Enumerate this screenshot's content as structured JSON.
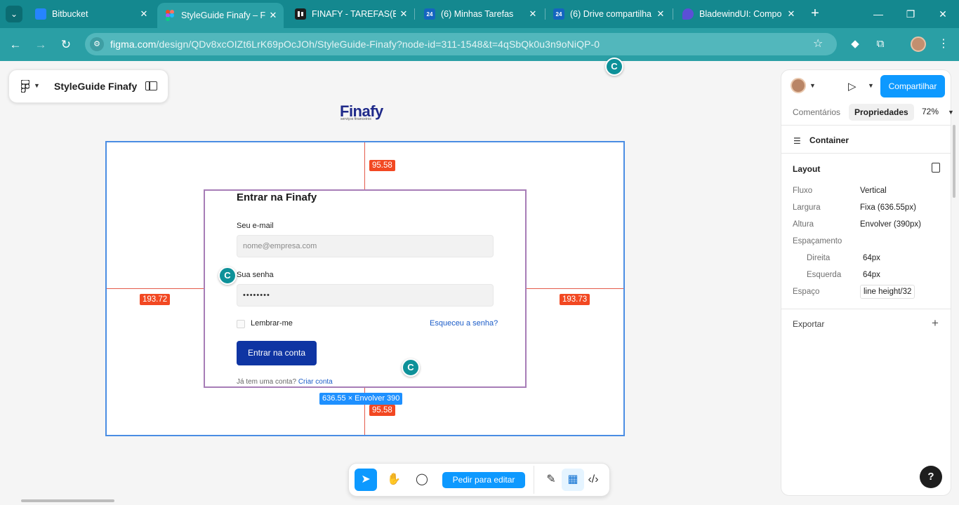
{
  "browser": {
    "tab_menu_icon": "chevron-down-icon",
    "tabs": [
      {
        "title": "Bitbucket",
        "favicon_color": "#2684ff",
        "favicon_text": ""
      },
      {
        "title": "StyleGuide Finafy – Fi",
        "favicon_color": "#a259ff",
        "favicon_text": ""
      },
      {
        "title": "FINAFY - TAREFAS(BIT",
        "favicon_color": "#1d1d1d",
        "favicon_text": ""
      },
      {
        "title": "(6) Minhas Tarefas",
        "favicon_color": "#1565c0",
        "favicon_text": "24"
      },
      {
        "title": "(6) Drive compartilha",
        "favicon_color": "#1565c0",
        "favicon_text": "24"
      },
      {
        "title": "BladewindUI: Compo",
        "favicon_color": "#5b4fd6",
        "favicon_text": ""
      }
    ],
    "close_glyph": "✕",
    "url_domain": "figma.com",
    "url_path": "/design/QDv8xcOIZt6LrK69pOcJOh/StyleGuide-Finafy?node-id=311-1548&t=4qSbQk0u3n9oNiQP-0"
  },
  "figma": {
    "file_name": "StyleGuide Finafy",
    "collaborator_initial": "C",
    "edit_button": "Pedir para editar",
    "share_button": "Compartilhar",
    "panel_tabs": [
      "Comentários",
      "Propriedades"
    ],
    "zoom": "72%",
    "selected_component": "Container",
    "layout_title": "Layout",
    "export_title": "Exportar",
    "properties": [
      {
        "label": "Fluxo",
        "value": "Vertical"
      },
      {
        "label": "Largura",
        "value": "Fixa (636.55px)"
      },
      {
        "label": "Altura",
        "value": "Envolver (390px)"
      },
      {
        "label": "Espaçamento",
        "value": ""
      },
      {
        "label": "Direita",
        "value": "64px"
      },
      {
        "label": "Esquerda",
        "value": "64px"
      },
      {
        "label": "Espaço",
        "value": "line height/32"
      }
    ],
    "help": "?"
  },
  "design": {
    "brand": "Finafy",
    "brand_tagline": "serviços financeiros",
    "measures": {
      "top": "95.58",
      "bottom": "95.58",
      "left": "193.72",
      "right": "193.73"
    },
    "size_badge": "636.55 × Envolver  390",
    "login": {
      "title": "Entrar na Finafy",
      "email_label": "Seu e-mail",
      "email_placeholder": "nome@empresa.com",
      "password_label": "Sua senha",
      "password_value": "••••••••",
      "remember": "Lembrar-me",
      "forgot": "Esqueceu a senha?",
      "submit": "Entrar na conta",
      "signup_prompt": "Já tem uma conta?",
      "signup_link": "Criar conta"
    }
  }
}
